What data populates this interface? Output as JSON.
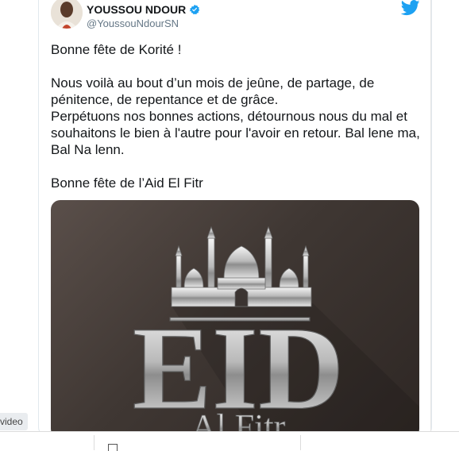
{
  "tweet": {
    "author_name": "YOUSSOU NDOUR",
    "author_handle": "@YoussouNdourSN",
    "body": "Bonne fête de Korité !\n\nNous voilà au bout d’un mois de jeûne, de partage, de pénitence, de repentance et de grâce.\nPerpétuons nos bonnes actions, détournous nous du mal et souhaitons le bien à l'autre pour l'avoir en retour. Bal lene ma, Bal Na lenn.\n\nBonne fête de l’Aid El Fitr",
    "image": {
      "headline": "EID",
      "subline": "Al Fitr"
    }
  },
  "overlay": {
    "video_label": "video"
  },
  "colors": {
    "twitter_blue": "#1da1f2",
    "text": "#14171a",
    "secondary_text": "#657786"
  }
}
